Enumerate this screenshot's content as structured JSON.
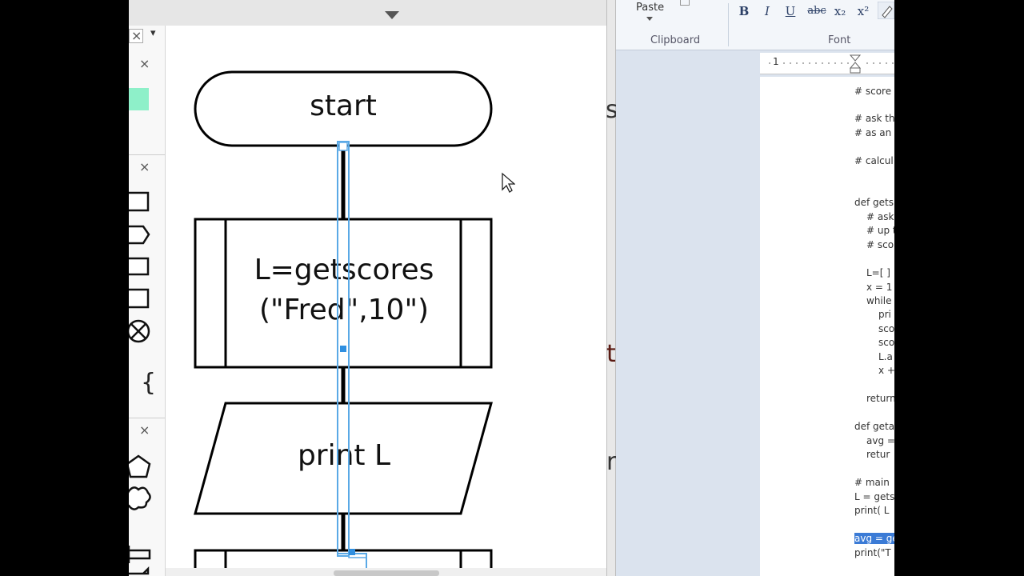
{
  "flowchart": {
    "start_label": "start",
    "process_line1": "L=getscores",
    "process_line2": "(\"Fred\",10\")",
    "io_label": "print L"
  },
  "panel": {
    "close_glyph": "×",
    "dropdown_glyph": "▾",
    "tag_shape_glyph": "{"
  },
  "word": {
    "paste_label": "Paste",
    "clipboard_label": "Clipboard",
    "font_label": "Font",
    "format_buttons": [
      "B",
      "I",
      "U",
      "abc",
      "x₂",
      "x²"
    ],
    "ruler_mark": "1",
    "code_lines": [
      "# score",
      "# ask th",
      "# as an",
      "# calcul",
      "def gets",
      "  # ask",
      "  # up t",
      "  # sco",
      "  L=[ ]",
      "  x = 1",
      "  while",
      "     pri",
      "     sco",
      "     sco",
      "     L.a",
      "     x +=",
      "  return",
      "def geta",
      "  avg =",
      "  retur",
      "# main",
      "L = gets",
      "print( L",
      "avg = ge",
      "print(\"T"
    ]
  },
  "background_fragments": [
    "s",
    "t",
    "r"
  ],
  "colors": {
    "selection": "#5aa9e6",
    "highlight": "#3b7bd6",
    "accent_swatch": "#8ef0c9"
  }
}
